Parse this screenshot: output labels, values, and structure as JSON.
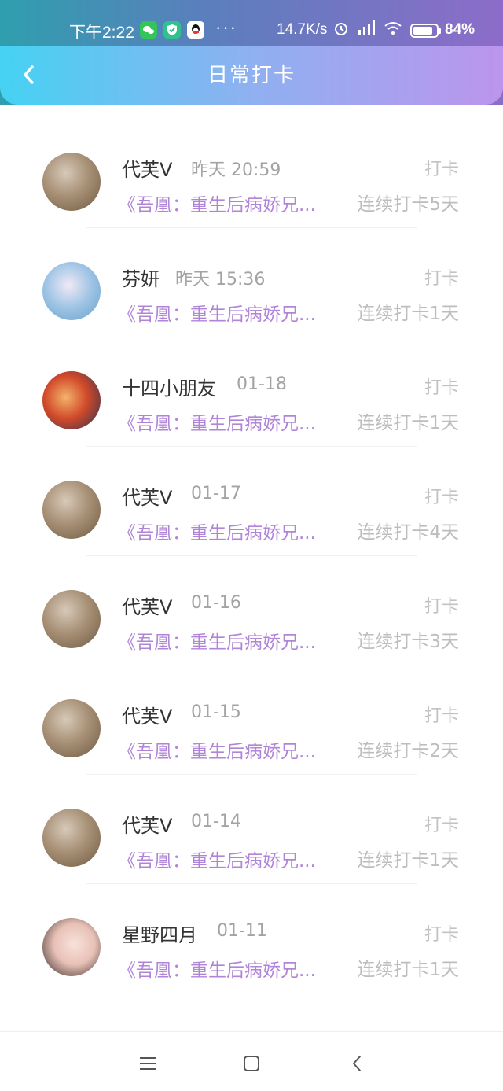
{
  "status_bar": {
    "time": "下午2:22",
    "apps": [
      "wechat-icon",
      "shield-icon",
      "qq-icon"
    ],
    "more": "···",
    "net_speed": "14.7K/s",
    "battery": "84%",
    "battery_level": 0.84
  },
  "header": {
    "title": "日常打卡"
  },
  "list": {
    "items": [
      {
        "name": "代芙V",
        "time": "昨天 20:59",
        "action": "打卡",
        "book": "《吾凰：重生后病娇兄...",
        "streak": "连续打卡5天",
        "avatar": "brown"
      },
      {
        "name": "芬妍",
        "time": "昨天 15:36",
        "action": "打卡",
        "book": "《吾凰：重生后病娇兄...",
        "streak": "连续打卡1天",
        "avatar": "blue"
      },
      {
        "name": "十四小朋友",
        "time": "01-18",
        "action": "打卡",
        "book": "《吾凰：重生后病娇兄...",
        "streak": "连续打卡1天",
        "avatar": "red"
      },
      {
        "name": "代芙V",
        "time": "01-17",
        "action": "打卡",
        "book": "《吾凰：重生后病娇兄...",
        "streak": "连续打卡4天",
        "avatar": "brown"
      },
      {
        "name": "代芙V",
        "time": "01-16",
        "action": "打卡",
        "book": "《吾凰：重生后病娇兄...",
        "streak": "连续打卡3天",
        "avatar": "brown"
      },
      {
        "name": "代芙V",
        "time": "01-15",
        "action": "打卡",
        "book": "《吾凰：重生后病娇兄...",
        "streak": "连续打卡2天",
        "avatar": "brown"
      },
      {
        "name": "代芙V",
        "time": "01-14",
        "action": "打卡",
        "book": "《吾凰：重生后病娇兄...",
        "streak": "连续打卡1天",
        "avatar": "brown"
      },
      {
        "name": "星野四月",
        "time": "01-11",
        "action": "打卡",
        "book": "《吾凰：重生后病娇兄...",
        "streak": "连续打卡1天",
        "avatar": "girl"
      }
    ]
  },
  "nav_bar": {
    "buttons": [
      "menu-icon",
      "home-square-icon",
      "back-triangle-icon"
    ]
  }
}
